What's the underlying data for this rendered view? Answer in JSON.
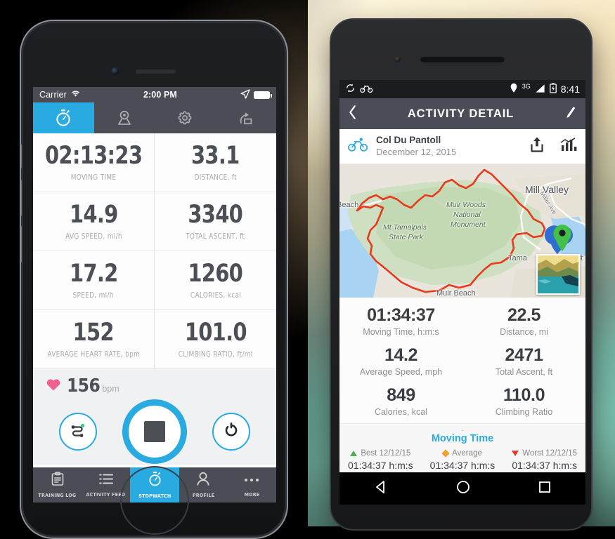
{
  "ios": {
    "status": {
      "carrier": "Carrier",
      "time": "2:00 PM",
      "wifi_icon": "wifi-icon",
      "location_icon": "location-arrow-icon",
      "battery_icon": "battery-icon"
    },
    "top_tabs": [
      {
        "name": "stopwatch",
        "icon": "stopwatch-icon",
        "active": true
      },
      {
        "name": "map",
        "icon": "map-pin-icon",
        "active": false
      },
      {
        "name": "settings",
        "icon": "gear-icon",
        "active": false
      },
      {
        "name": "share",
        "icon": "share-export-icon",
        "active": false
      }
    ],
    "metrics": [
      {
        "value": "02:13:23",
        "label": "MOVING TIME"
      },
      {
        "value": "33.1",
        "label": "DISTANCE, ft"
      },
      {
        "value": "14.9",
        "label": "AVG SPEED, mi/h"
      },
      {
        "value": "3340",
        "label": "TOTAL ASCENT, ft"
      },
      {
        "value": "17.2",
        "label": "SPEED, mi/h"
      },
      {
        "value": "1260",
        "label": "CALORIES, kcal"
      },
      {
        "value": "152",
        "label": "AVERAGE HEART RATE, bpm"
      },
      {
        "value": "101.0",
        "label": "CLIMBING RATIO, ft/mi"
      }
    ],
    "heart_rate": {
      "value": "156",
      "unit": "bpm",
      "icon": "heart-icon",
      "color": "#f2608f"
    },
    "controls": [
      {
        "name": "route-button",
        "icon": "route-icon"
      },
      {
        "name": "stop-button",
        "icon": "stop-square-icon"
      },
      {
        "name": "lap-reset-button",
        "icon": "lap-refresh-icon"
      }
    ],
    "bottom_tabs": [
      {
        "label": "TRAINING LOG",
        "icon": "clipboard-icon",
        "active": false
      },
      {
        "label": "ACTIVITY FEED",
        "icon": "list-icon",
        "active": false
      },
      {
        "label": "STOPWATCH",
        "icon": "stopwatch-icon",
        "active": true
      },
      {
        "label": "PROFILE",
        "icon": "person-icon",
        "active": false
      },
      {
        "label": "MORE",
        "icon": "ellipsis-icon",
        "active": false
      }
    ],
    "accent_color": "#29abe2",
    "bar_color": "#4a4d55"
  },
  "android": {
    "status": {
      "sync_icon": "sync-icon",
      "bike_icon": "bicycle-icon",
      "location_icon": "location-pin-icon",
      "network": "3G",
      "signal_icon": "signal-bars-icon",
      "battery_icon": "battery-charging-icon",
      "time": "8:41"
    },
    "appbar": {
      "back_icon": "chevron-left-icon",
      "title": "ACTIVITY DETAIL",
      "edit_icon": "pencil-icon"
    },
    "activity": {
      "sport_icon": "bicycle-icon",
      "name": "Col Du Pantoll",
      "date": "December 12, 2015",
      "share_icon": "share-icon",
      "chart_icon": "chart-bars-icon"
    },
    "map": {
      "labels": [
        {
          "text": "Mill Valley",
          "kind": "city"
        },
        {
          "text": "Muir Woods",
          "kind": "park"
        },
        {
          "text": "National",
          "kind": "park"
        },
        {
          "text": "Monument",
          "kind": "park"
        },
        {
          "text": "Mt Tamalpais",
          "kind": "park"
        },
        {
          "text": "State Park",
          "kind": "park"
        },
        {
          "text": "Muir Beach",
          "kind": "place"
        },
        {
          "text": "Beach",
          "kind": "place"
        },
        {
          "text": "Tama",
          "kind": "place"
        },
        {
          "text": "st",
          "kind": "place"
        },
        {
          "text": "Miller Ave",
          "kind": "street"
        }
      ],
      "route_color": "#e8391a",
      "pin_icon": "map-marker-icon",
      "photo_thumbnail": "landscape-photo-thumbnail"
    },
    "stats": [
      {
        "value": "01:34:37",
        "label": "Moving Time, h:m:s"
      },
      {
        "value": "22.5",
        "label": "Distance, mi"
      },
      {
        "value": "14.2",
        "label": "Average Speed, mph"
      },
      {
        "value": "2471",
        "label": "Total Ascent, ft"
      },
      {
        "value": "849",
        "label": "Calories, kcal"
      },
      {
        "value": "110.0",
        "label": "Climbing Ratio"
      }
    ],
    "comparison": {
      "dot": "·",
      "title": "Moving Time",
      "columns": [
        {
          "marker": "triangle-up",
          "color": "#4caf50",
          "head": "Best 12/12/15",
          "value": "01:34:37 h:m:s"
        },
        {
          "marker": "diamond",
          "color": "#f0a030",
          "head": "Average",
          "value": "01:34:37 h:m:s"
        },
        {
          "marker": "triangle-down",
          "color": "#e03a2f",
          "head": "Worst 12/12/15",
          "value": "01:34:37 h:m:s"
        }
      ]
    },
    "nav": [
      {
        "name": "back-button",
        "icon": "triangle-back-icon"
      },
      {
        "name": "home-button",
        "icon": "circle-home-icon"
      },
      {
        "name": "recents-button",
        "icon": "square-recents-icon"
      }
    ],
    "accent_color": "#29abe2",
    "bar_color": "#4a4d57"
  }
}
